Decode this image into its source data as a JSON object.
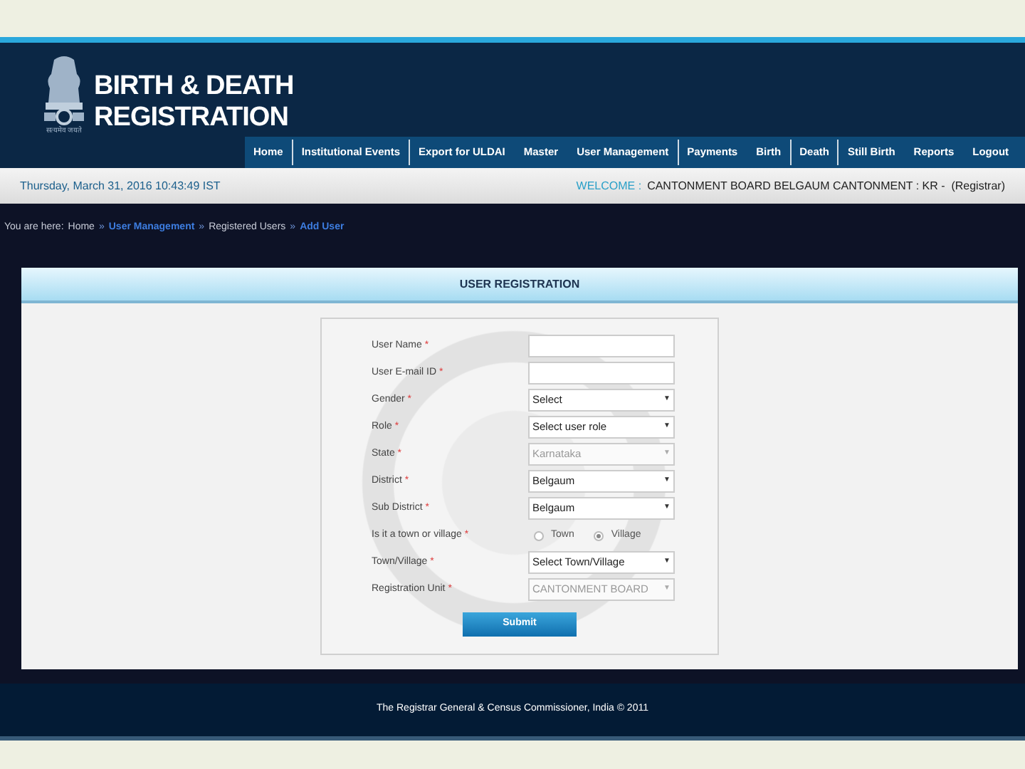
{
  "header": {
    "title_line_1": "BIRTH & DEATH",
    "title_line_2": "REGISTRATION",
    "emblem_caption": "सत्यमेव जयते"
  },
  "nav": [
    {
      "label": "Home",
      "divider_after": true
    },
    {
      "label": "Institutional Events",
      "divider_after": true
    },
    {
      "label": "Export for ULDAI",
      "divider_after": false
    },
    {
      "label": "Master",
      "divider_after": false
    },
    {
      "label": "User Management",
      "divider_after": true
    },
    {
      "label": "Payments",
      "divider_after": false
    },
    {
      "label": "Birth",
      "divider_after": true
    },
    {
      "label": "Death",
      "divider_after": true
    },
    {
      "label": "Still Birth",
      "divider_after": false
    },
    {
      "label": "Reports",
      "divider_after": false
    },
    {
      "label": "Logout",
      "divider_after": false
    }
  ],
  "info_bar": {
    "datetime": "Thursday, March 31, 2016 10:43:49 IST",
    "welcome_label": "WELCOME :",
    "welcome_text": "CANTONMENT BOARD BELGAUM CANTONMENT : KR -  (Registrar)"
  },
  "breadcrumb": {
    "prefix": "You are here:",
    "items": [
      {
        "label": "Home",
        "link": false
      },
      {
        "label": "User Management",
        "link": true
      },
      {
        "label": "Registered Users",
        "link": false
      },
      {
        "label": "Add User",
        "link": true
      }
    ],
    "separator": "»"
  },
  "form": {
    "title": "USER REGISTRATION",
    "fields": [
      {
        "label": "User Name",
        "kind": "text"
      },
      {
        "label": "User E-mail ID",
        "kind": "text"
      },
      {
        "label": "Gender",
        "kind": "select",
        "value": "Select",
        "disabled": false
      },
      {
        "label": "Role",
        "kind": "select",
        "value": "Select user role",
        "disabled": false
      },
      {
        "label": "State",
        "kind": "select",
        "value": "Karnataka",
        "disabled": true
      },
      {
        "label": "District",
        "kind": "select",
        "value": "Belgaum",
        "disabled": false
      },
      {
        "label": "Sub District",
        "kind": "select",
        "value": "Belgaum",
        "disabled": false
      },
      {
        "label": "Is it a town or village",
        "kind": "radio",
        "options": [
          {
            "label": "Town",
            "selected": false
          },
          {
            "label": "Village",
            "selected": true
          }
        ]
      },
      {
        "label": "Town/Village",
        "kind": "select",
        "value": "Select Town/Village",
        "disabled": false
      },
      {
        "label": "Registration Unit",
        "kind": "select",
        "value": "CANTONMENT BOARD",
        "disabled": true
      }
    ],
    "required_mark": "*",
    "select_arrow": "▼",
    "submit": "Submit"
  },
  "footer": "The Registrar General & Census Commissioner, India © 2011"
}
